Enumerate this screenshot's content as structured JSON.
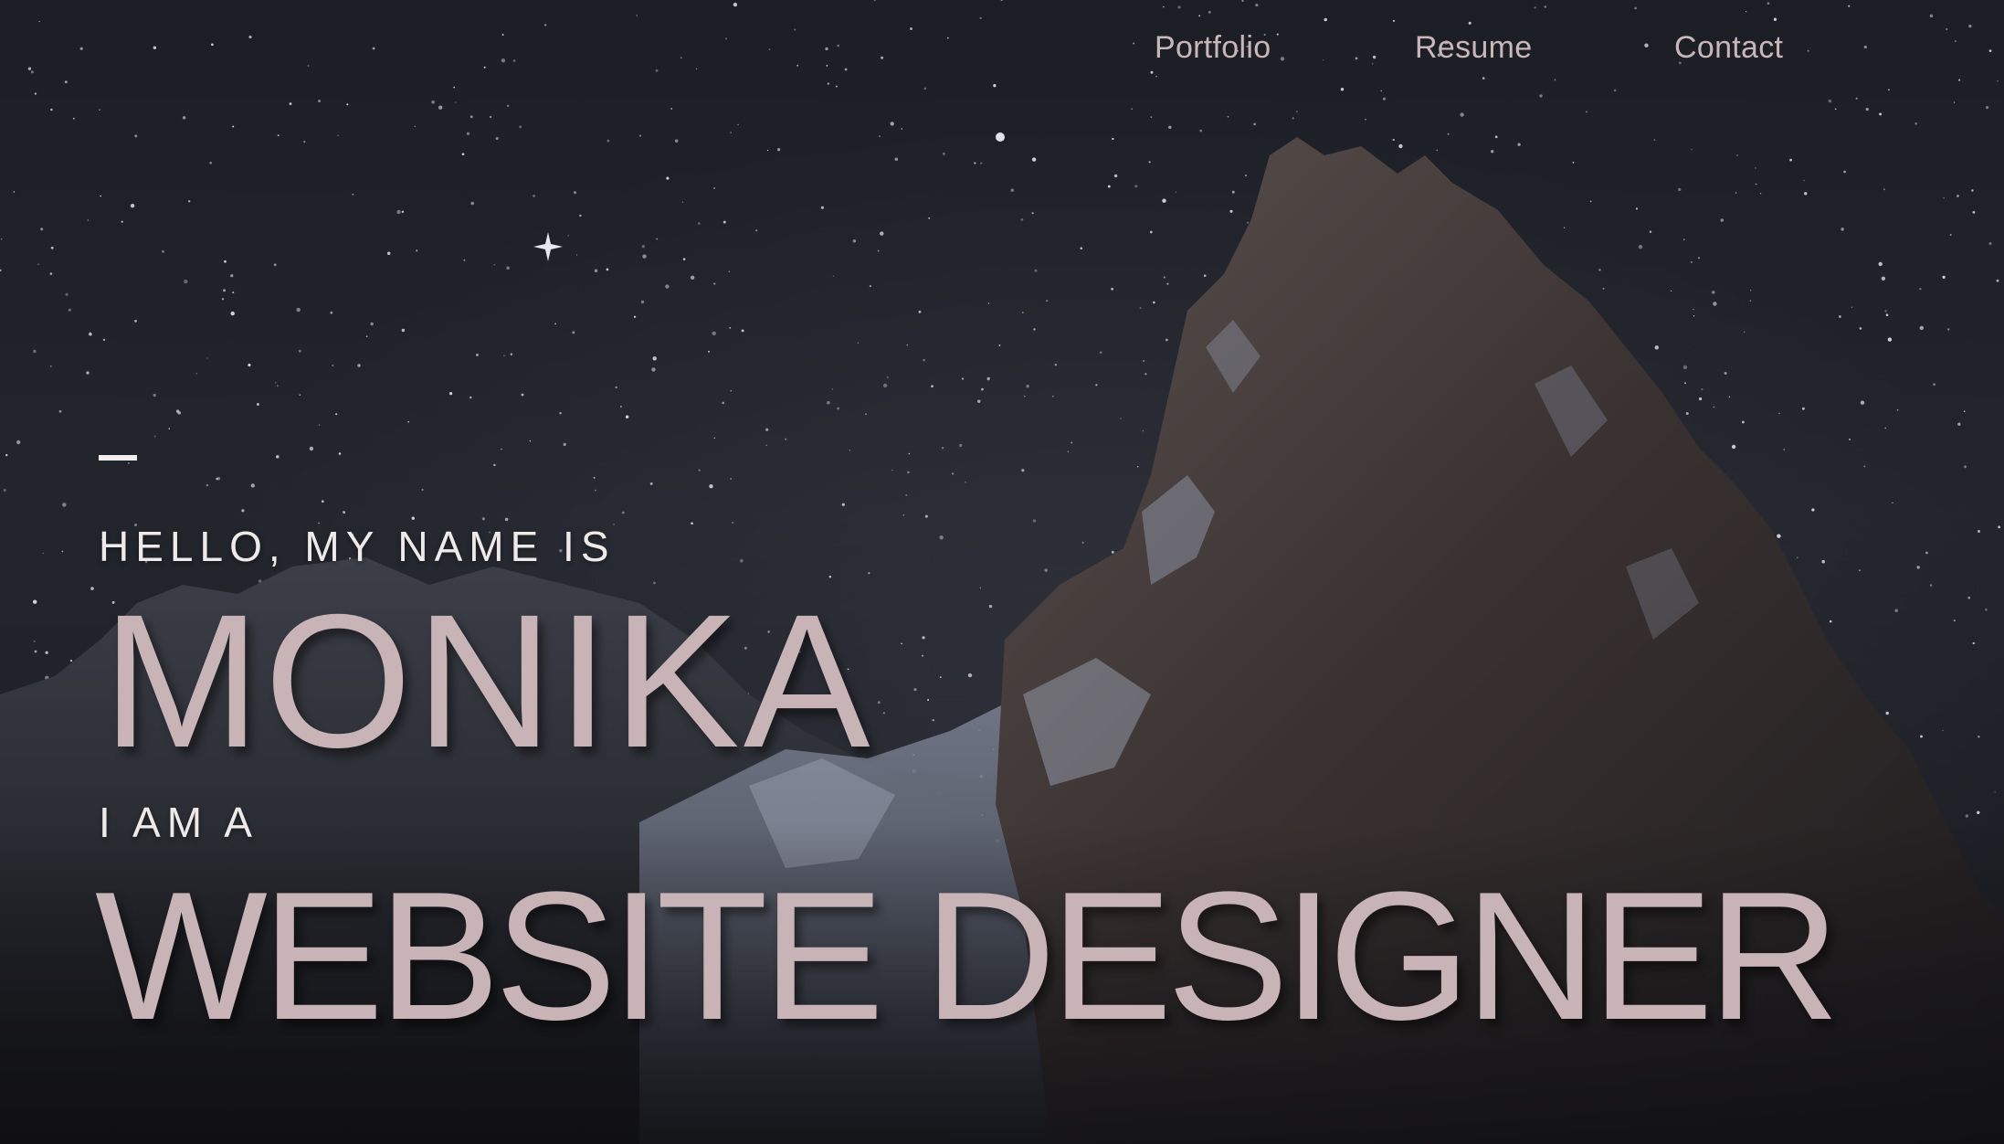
{
  "nav": {
    "items": [
      {
        "label": "Portfolio"
      },
      {
        "label": "Resume"
      },
      {
        "label": "Contact"
      }
    ]
  },
  "hero": {
    "greeting": "HELLO, MY NAME IS",
    "name": "MONIKA",
    "intro": "I AM A",
    "role": "WEBSITE DESIGNER"
  },
  "background": {
    "subject": "starry night sky over snowy mountain peak"
  },
  "colors": {
    "accent_pink": "#c8b3b6",
    "text_light": "#efeaea",
    "sky_dark": "#1d1f26"
  }
}
